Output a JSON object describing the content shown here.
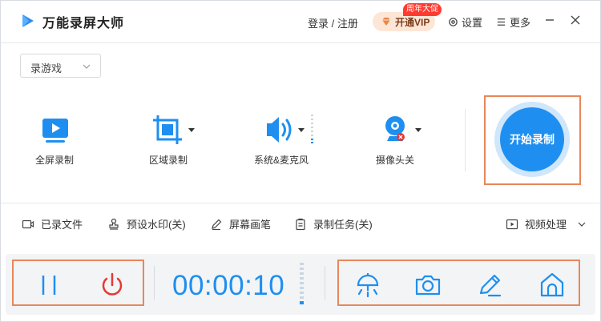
{
  "app": {
    "title": "万能录屏大师"
  },
  "header": {
    "login_label": "登录 / 注册",
    "vip_label": "开通VIP",
    "vip_tag": "周年大促",
    "settings_label": "设置",
    "more_label": "更多"
  },
  "mode_select": {
    "value": "录游戏"
  },
  "tools": [
    {
      "label": "全屏录制",
      "icon": "monitor-icon"
    },
    {
      "label": "区域录制",
      "icon": "crop-icon"
    },
    {
      "label": "系统&麦克风",
      "icon": "speaker-icon"
    },
    {
      "label": "摄像头关",
      "icon": "webcam-icon"
    }
  ],
  "record_button": {
    "label": "开始录制"
  },
  "subbar": {
    "files": "已录文件",
    "watermark": "预设水印(关)",
    "pen": "屏幕画笔",
    "task": "录制任务(关)",
    "video": "视频处理"
  },
  "controls": {
    "timer": "00:00:10"
  },
  "colors": {
    "accent": "#1e8ff0",
    "highlight": "#e8875a",
    "stop": "#e53935"
  }
}
